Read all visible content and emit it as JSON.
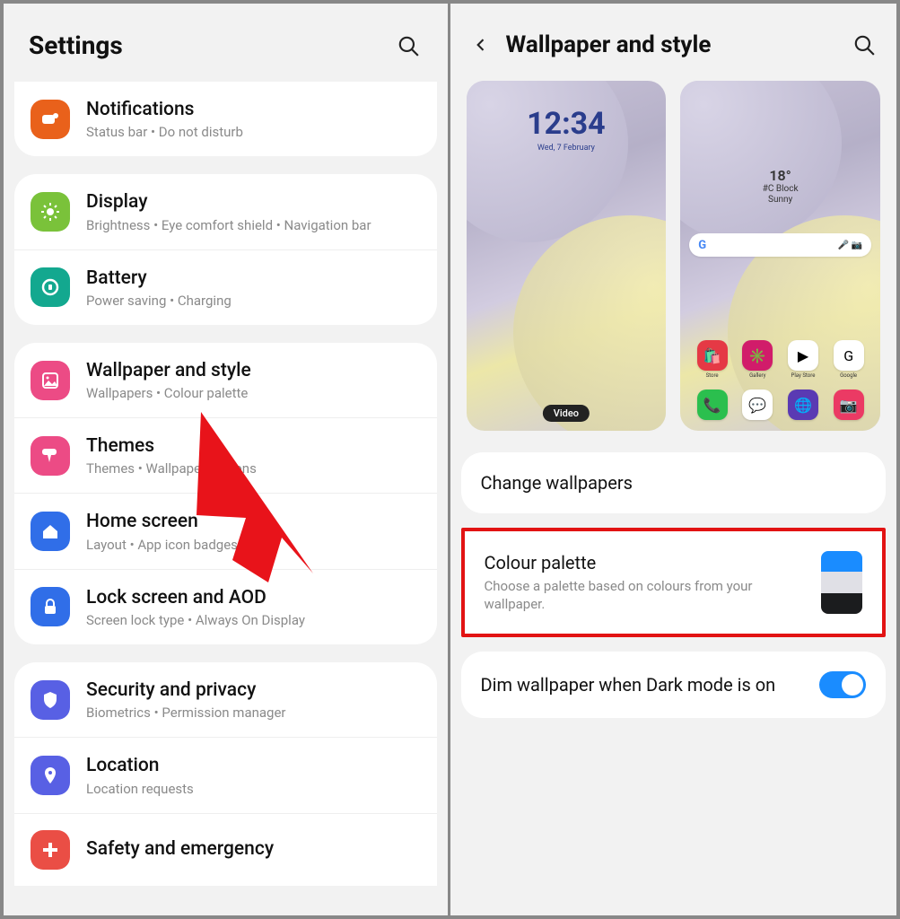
{
  "left": {
    "title": "Settings",
    "groups": [
      {
        "items": [
          {
            "key": "notifications",
            "title": "Notifications",
            "sub": "Status bar  •  Do not disturb"
          }
        ]
      },
      {
        "items": [
          {
            "key": "display",
            "title": "Display",
            "sub": "Brightness  •  Eye comfort shield  •  Navigation bar"
          },
          {
            "key": "battery",
            "title": "Battery",
            "sub": "Power saving  •  Charging"
          }
        ]
      },
      {
        "items": [
          {
            "key": "wallpaper",
            "title": "Wallpaper and style",
            "sub": "Wallpapers  •  Colour palette"
          },
          {
            "key": "themes",
            "title": "Themes",
            "sub": "Themes  •  Wallpapers  •  Icons"
          },
          {
            "key": "home",
            "title": "Home screen",
            "sub": "Layout  •  App icon badges"
          },
          {
            "key": "lock",
            "title": "Lock screen and AOD",
            "sub": "Screen lock type  •  Always On Display"
          }
        ]
      },
      {
        "items": [
          {
            "key": "security",
            "title": "Security and privacy",
            "sub": "Biometrics  •  Permission manager"
          },
          {
            "key": "location",
            "title": "Location",
            "sub": "Location requests"
          },
          {
            "key": "safety",
            "title": "Safety and emergency",
            "sub": ""
          }
        ]
      }
    ]
  },
  "right": {
    "title": "Wallpaper and style",
    "lock_preview": {
      "time": "12:34",
      "date": "Wed, 7 February",
      "video_label": "Video"
    },
    "home_preview": {
      "temp": "18°",
      "loc": "#C Block",
      "cond": "Sunny",
      "apps_row": [
        {
          "name": "Store",
          "bg": "#e53945",
          "emoji": "🛍️"
        },
        {
          "name": "Gallery",
          "bg": "#d11c6a",
          "emoji": "✳️"
        },
        {
          "name": "Play Store",
          "bg": "#ffffff",
          "emoji": "▶"
        },
        {
          "name": "Google",
          "bg": "#ffffff",
          "emoji": "G"
        }
      ],
      "dock": [
        {
          "bg": "#2bbf4e",
          "emoji": "📞"
        },
        {
          "bg": "#ffffff",
          "emoji": "💬"
        },
        {
          "bg": "#5a3ab3",
          "emoji": "🌐"
        },
        {
          "bg": "#eb3a64",
          "emoji": "📷"
        }
      ]
    },
    "options": {
      "change": "Change wallpapers",
      "palette_title": "Colour palette",
      "palette_sub": "Choose a palette based on colours from your wallpaper.",
      "dim_title": "Dim wallpaper when Dark mode is on",
      "dim_on": true
    }
  }
}
